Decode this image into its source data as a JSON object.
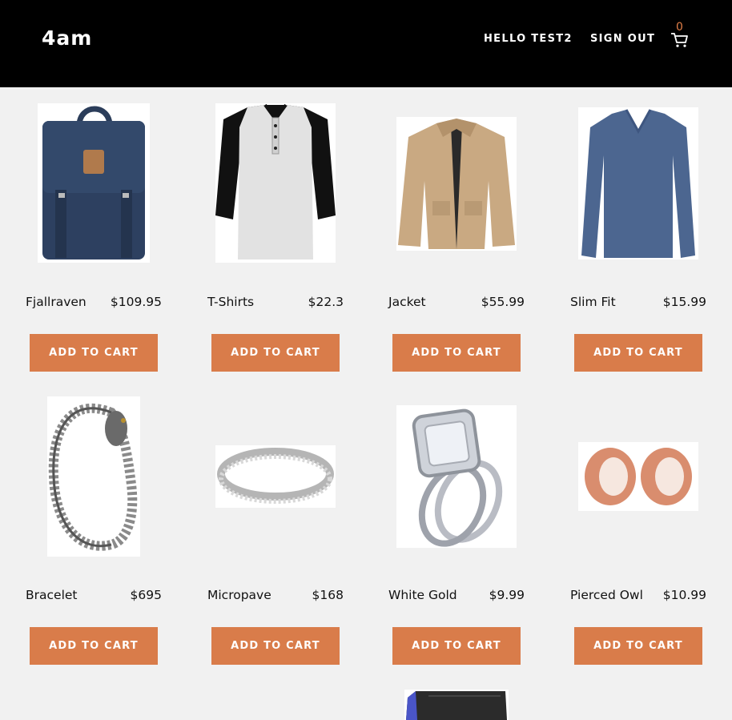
{
  "header": {
    "logo": "4am",
    "greeting": "HELLO TEST2",
    "sign_out": "SIGN OUT",
    "cart_count": "0"
  },
  "products": [
    {
      "name": "Fjallraven",
      "price": "$109.95",
      "button": "ADD TO CART",
      "image": "navy-backpack"
    },
    {
      "name": "T-Shirts",
      "price": "$22.3",
      "button": "ADD TO CART",
      "image": "raglan-henley-tshirt"
    },
    {
      "name": "Jacket",
      "price": "$55.99",
      "button": "ADD TO CART",
      "image": "khaki-jacket"
    },
    {
      "name": "Slim Fit",
      "price": "$15.99",
      "button": "ADD TO CART",
      "image": "blue-long-sleeve-shirt"
    },
    {
      "name": "Bracelet",
      "price": "$695",
      "button": "ADD TO CART",
      "image": "dragon-chain-bracelet"
    },
    {
      "name": "Micropave",
      "price": "$168",
      "button": "ADD TO CART",
      "image": "silver-band-ring"
    },
    {
      "name": "White Gold",
      "price": "$9.99",
      "button": "ADD TO CART",
      "image": "diamond-ring-set"
    },
    {
      "name": "Pierced Owl",
      "price": "$10.99",
      "button": "ADD TO CART",
      "image": "rose-gold-tunnel-plugs"
    }
  ],
  "colors": {
    "header_bg": "#000000",
    "accent": "#d97c4a",
    "page_bg": "#f1f1f1"
  }
}
